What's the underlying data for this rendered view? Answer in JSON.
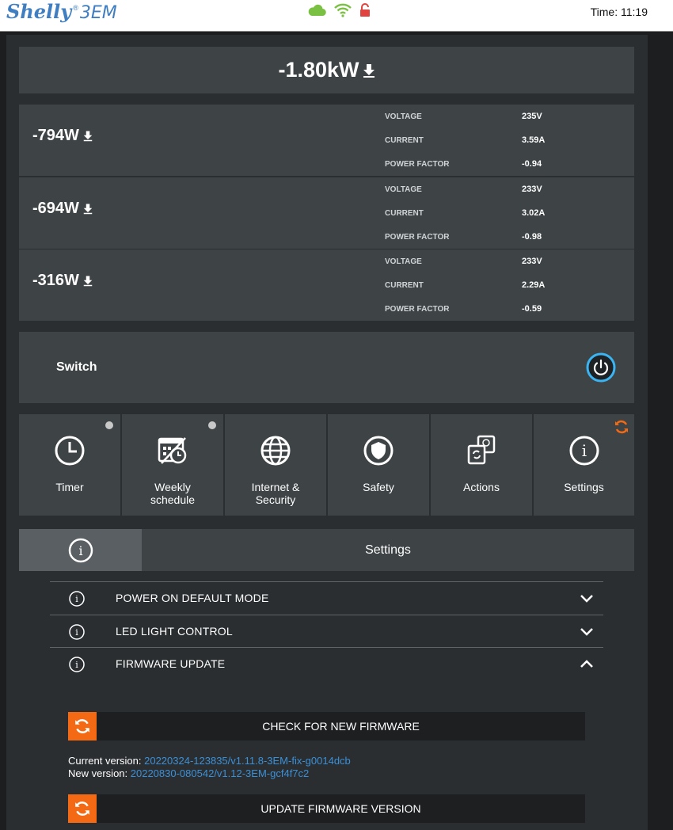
{
  "header": {
    "brand": "Shelly",
    "reg": "®",
    "model": "3EM",
    "time_label": "Time:",
    "time_value": "11:19",
    "icons": [
      "cloud-icon",
      "wifi-icon",
      "lock-open-icon"
    ],
    "colors": {
      "cloud": "#7ac143",
      "wifi": "#7ac143",
      "lock": "#e0443f",
      "brand": "#3f7ec1"
    }
  },
  "total": {
    "power": "-1.80kW"
  },
  "phases": [
    {
      "power": "-794W",
      "voltage_label": "VOLTAGE",
      "voltage": "235V",
      "current_label": "CURRENT",
      "current": "3.59A",
      "pf_label": "POWER FACTOR",
      "pf": "-0.94"
    },
    {
      "power": "-694W",
      "voltage_label": "VOLTAGE",
      "voltage": "233V",
      "current_label": "CURRENT",
      "current": "3.02A",
      "pf_label": "POWER FACTOR",
      "pf": "-0.98"
    },
    {
      "power": "-316W",
      "voltage_label": "VOLTAGE",
      "voltage": "233V",
      "current_label": "CURRENT",
      "current": "2.29A",
      "pf_label": "POWER FACTOR",
      "pf": "-0.59"
    }
  ],
  "switch": {
    "label": "Switch",
    "accent": "#3ab4f2"
  },
  "tiles": [
    {
      "label": "Timer",
      "icon": "clock-icon"
    },
    {
      "label": "Weekly\nschedule",
      "icon": "calendar-icon"
    },
    {
      "label": "Internet &\nSecurity",
      "icon": "globe-icon"
    },
    {
      "label": "Safety",
      "icon": "shield-icon"
    },
    {
      "label": "Actions",
      "icon": "actions-icon"
    },
    {
      "label": "Settings",
      "icon": "info-icon"
    }
  ],
  "settings": {
    "title": "Settings",
    "sections": [
      {
        "label": "POWER ON DEFAULT MODE",
        "state": "collapsed"
      },
      {
        "label": "LED LIGHT CONTROL",
        "state": "collapsed"
      },
      {
        "label": "FIRMWARE UPDATE",
        "state": "expanded"
      }
    ],
    "check_button": "CHECK FOR NEW FIRMWARE",
    "current_label": "Current version:",
    "current_version": "20220324-123835/v1.11.8-3EM-fix-g0014dcb",
    "new_label": "New version:",
    "new_version": "20220830-080542/v1.12-3EM-gcf4f7c2",
    "update_button": "UPDATE FIRMWARE VERSION",
    "accent": "#f46a14"
  }
}
